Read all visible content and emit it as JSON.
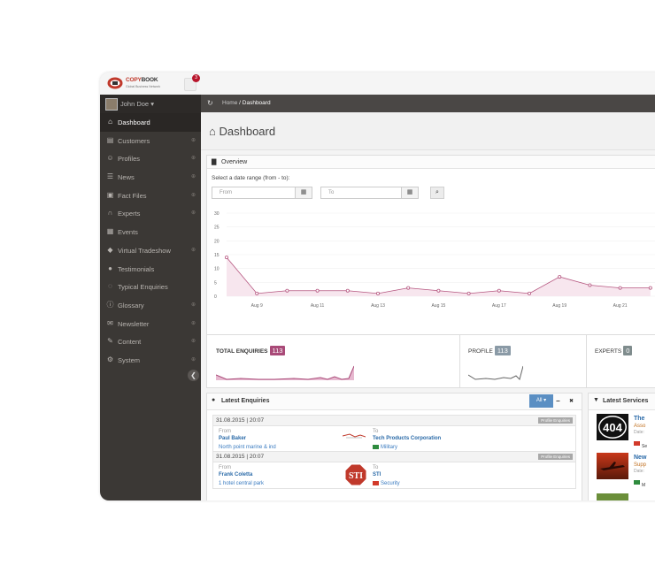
{
  "brand": {
    "name_a": "COPY",
    "name_b": "BOOK",
    "tagline": "Global Business Network"
  },
  "notifications": {
    "count": "3"
  },
  "user": {
    "name": "John Doe ▾"
  },
  "sidebar": {
    "items": [
      {
        "label": "Dashboard",
        "icon": "home-icon",
        "glyph": "⌂",
        "active": true
      },
      {
        "label": "Customers",
        "icon": "briefcase-icon",
        "glyph": "▤",
        "expandable": true
      },
      {
        "label": "Profiles",
        "icon": "users-icon",
        "glyph": "☺",
        "expandable": true
      },
      {
        "label": "News",
        "icon": "newspaper-icon",
        "glyph": "☰",
        "expandable": true
      },
      {
        "label": "Fact Files",
        "icon": "folder-icon",
        "glyph": "▣",
        "expandable": true
      },
      {
        "label": "Experts",
        "icon": "headphones-icon",
        "glyph": "∩",
        "expandable": true
      },
      {
        "label": "Events",
        "icon": "calendar-icon",
        "glyph": "▦",
        "expandable": false
      },
      {
        "label": "Virtual Tradeshow",
        "icon": "tag-icon",
        "glyph": "◆",
        "expandable": true
      },
      {
        "label": "Testimonials",
        "icon": "comment-icon",
        "glyph": "●",
        "expandable": false
      },
      {
        "label": "Typical Enquiries",
        "icon": "comments-icon",
        "glyph": "◌",
        "expandable": false
      },
      {
        "label": "Glossary",
        "icon": "info-icon",
        "glyph": "ⓘ",
        "expandable": true
      },
      {
        "label": "Newsletter",
        "icon": "envelope-icon",
        "glyph": "✉",
        "expandable": true
      },
      {
        "label": "Content",
        "icon": "edit-icon",
        "glyph": "✎",
        "expandable": true
      },
      {
        "label": "System",
        "icon": "cogs-icon",
        "glyph": "⚙",
        "expandable": true
      }
    ],
    "expand_glyph": "⊕",
    "collapse_glyph": "❮"
  },
  "breadcrumb": {
    "home": "Home",
    "sep": " / ",
    "current": "Dashboard"
  },
  "page": {
    "title": "Dashboard"
  },
  "overview": {
    "title": "Overview",
    "range_label": "Select a date range (from - to):",
    "from_placeholder": "From",
    "to_placeholder": "To"
  },
  "chart_data": {
    "type": "area",
    "title": "",
    "xlabel": "",
    "ylabel": "",
    "x_ticks": [
      "Aug 9",
      "Aug 11",
      "Aug 13",
      "Aug 15",
      "Aug 17",
      "Aug 19",
      "Aug 21"
    ],
    "x": [
      "Aug 8",
      "Aug 9",
      "Aug 10",
      "Aug 11",
      "Aug 12",
      "Aug 13",
      "Aug 14",
      "Aug 15",
      "Aug 16",
      "Aug 17",
      "Aug 18",
      "Aug 19",
      "Aug 20",
      "Aug 21",
      "Aug 22"
    ],
    "y_ticks": [
      0,
      5,
      10,
      15,
      20,
      25,
      30
    ],
    "ylim": [
      0,
      30
    ],
    "series": [
      {
        "values": [
          14,
          1,
          2,
          2,
          2,
          1,
          3,
          2,
          1,
          2,
          1,
          7,
          4,
          3,
          3
        ]
      }
    ],
    "grid": true,
    "color": "#b5557f"
  },
  "stats": {
    "total_label": "TOTAL ENQUIRIES",
    "total_value": "113",
    "profile_label": "PROFILE",
    "profile_value": "113",
    "experts_label": "EXPERTS",
    "experts_value": "0"
  },
  "latest_enquiries": {
    "title": "Latest Enquiries",
    "filter_label": "All ▾",
    "minimize": "−",
    "close": "✖",
    "items": [
      {
        "date": "31.08.2015 | 20:07",
        "badge": "Profile Enquiries",
        "from_label": "From",
        "from_name": "Paul Baker",
        "from_company": "North point marine & ind",
        "to_label": "To",
        "to_name": "Tech Products Corporation",
        "to_category": "Military",
        "logo": "tpc"
      },
      {
        "date": "31.08.2015 | 20:07",
        "badge": "Profile Enquiries",
        "from_label": "From",
        "from_name": "Frank Coletta",
        "from_company": "1 hotel central park",
        "to_label": "To",
        "to_name": "STI",
        "to_category": "Security",
        "logo": "sti",
        "logo_text": "STI"
      }
    ]
  },
  "latest_services": {
    "title": "Latest Services",
    "items": [
      {
        "title": "The",
        "sub": "Asso",
        "date": "Date:",
        "cat": "Se",
        "img_text": "404"
      },
      {
        "title": "New",
        "sub": "Supp",
        "date": "Date:",
        "cat": "M"
      }
    ]
  },
  "colors": {
    "accent": "#b5557f",
    "sidebar": "#3b3835",
    "profile_badge": "#8a9aa6",
    "experts_badge": "#7f8c8d",
    "total_badge": "#a94a78"
  }
}
